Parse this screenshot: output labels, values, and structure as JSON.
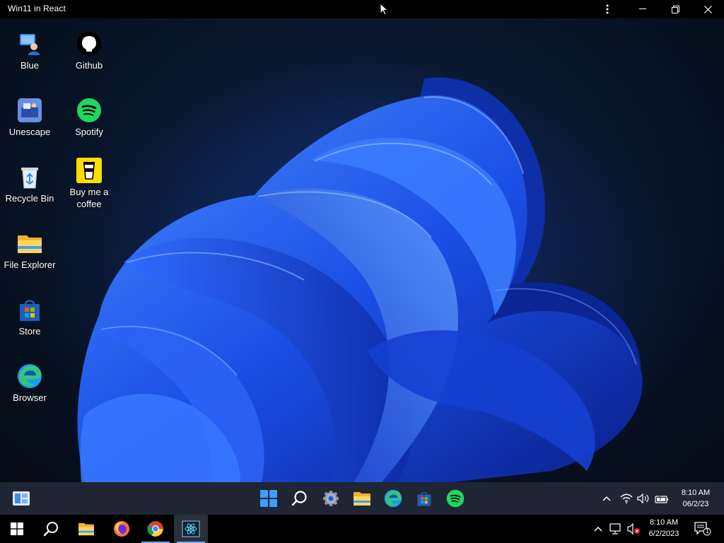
{
  "window": {
    "title": "Win11 in React"
  },
  "desktop_icons": [
    {
      "label": "Blue",
      "icon": "blue-user-icon"
    },
    {
      "label": "Github",
      "icon": "github-icon"
    },
    {
      "label": "Unescape",
      "icon": "unescape-icon"
    },
    {
      "label": "Spotify",
      "icon": "spotify-icon"
    },
    {
      "label": "Recycle Bin",
      "icon": "recycle-bin-icon"
    },
    {
      "label": "Buy me a",
      "label2": "coffee",
      "icon": "coffee-icon"
    },
    {
      "label": "File Explorer",
      "icon": "folder-icon"
    },
    {
      "label": "Store",
      "icon": "store-icon"
    },
    {
      "label": "Browser",
      "icon": "edge-icon"
    }
  ],
  "w11_taskbar": {
    "apps": [
      "start-icon",
      "search-icon",
      "settings-icon",
      "file-explorer-icon",
      "edge-icon",
      "store-icon",
      "spotify-icon"
    ],
    "tray": [
      "chevron-up-icon",
      "wifi-icon",
      "volume-icon",
      "battery-icon"
    ],
    "time": "8:10 AM",
    "date": "06/2/23"
  },
  "w10_taskbar": {
    "apps": [
      "windows-start-icon",
      "search-icon",
      "file-explorer-icon",
      "firefox-icon",
      "chrome-icon",
      "react-app-icon"
    ],
    "time": "8:10 AM",
    "date": "6/2/2023",
    "notification_count": "1"
  },
  "colors": {
    "accent": "#1f5bff",
    "taskbar_w11": "#1f2533",
    "taskbar_w10": "#000000"
  }
}
